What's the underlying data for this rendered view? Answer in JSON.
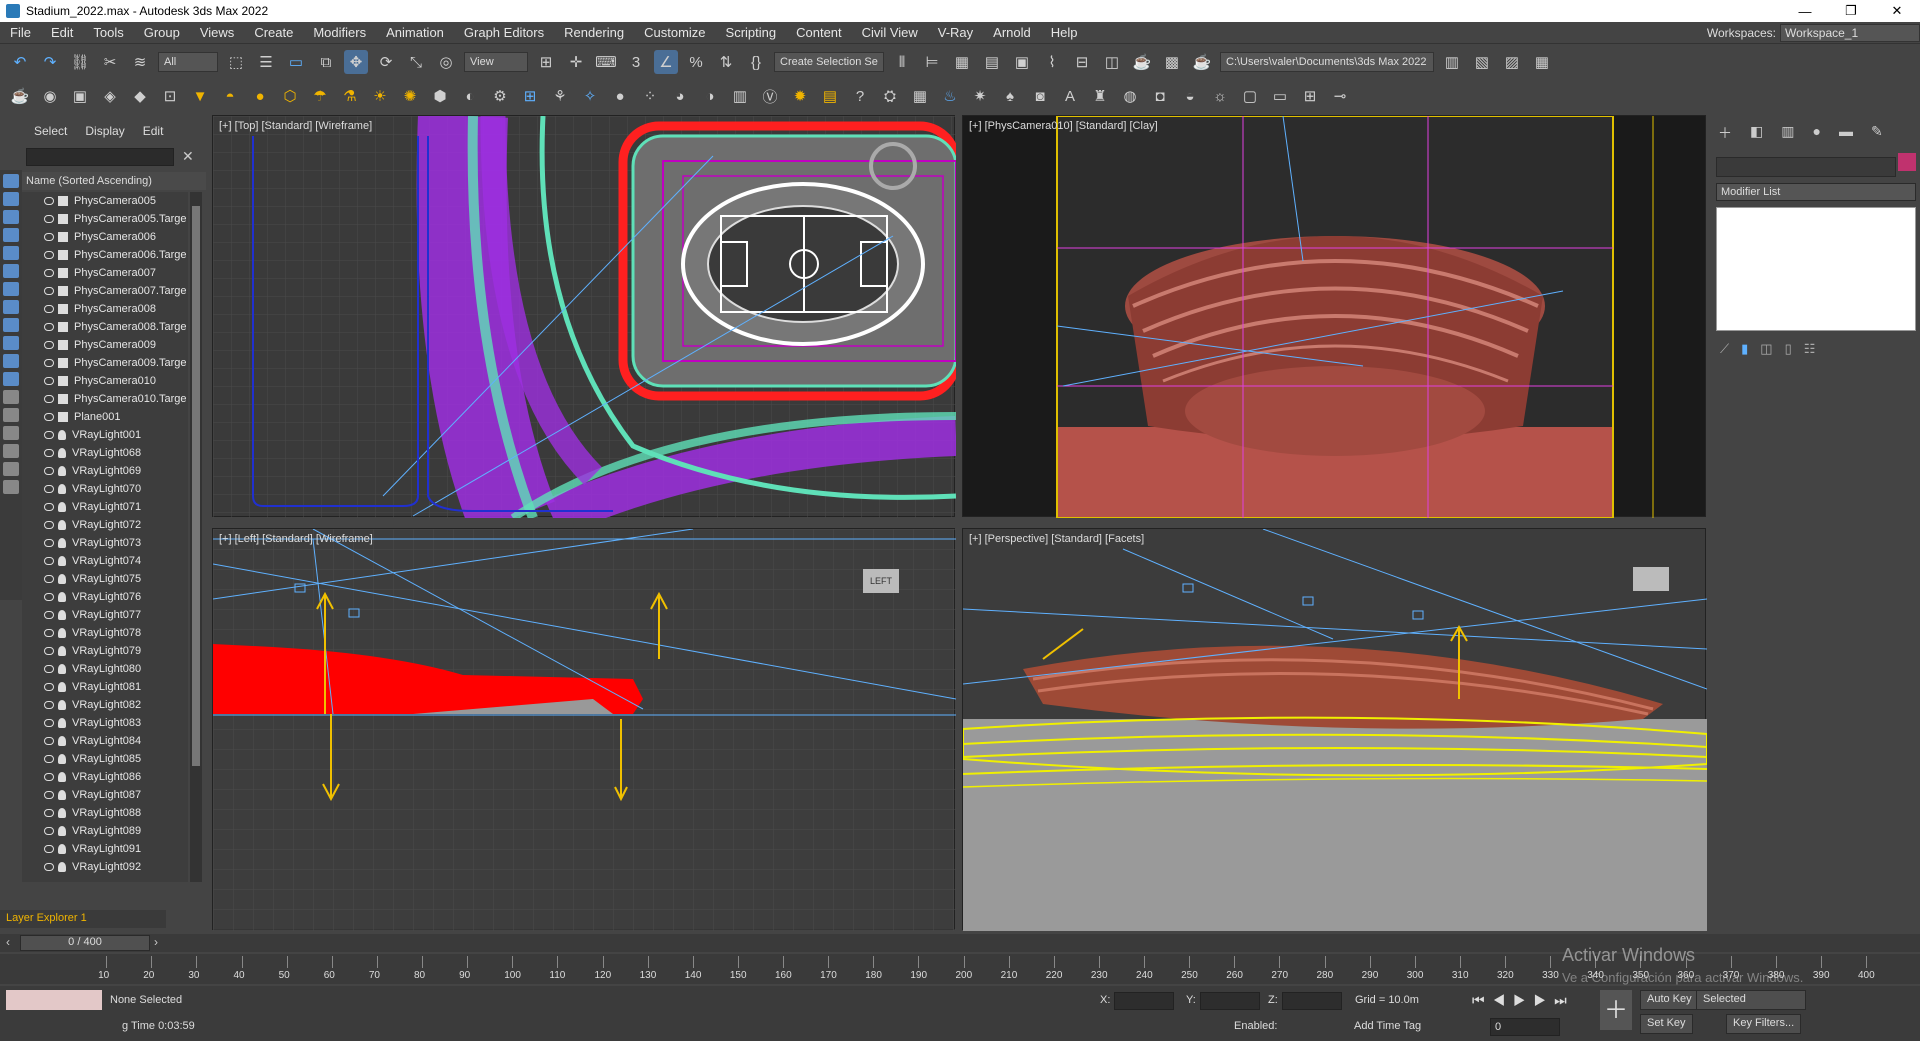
{
  "window": {
    "title": "Stadium_2022.max - Autodesk 3ds Max 2022",
    "min": "—",
    "max": "❐",
    "close": "✕"
  },
  "menu": {
    "items": [
      "File",
      "Edit",
      "Tools",
      "Group",
      "Views",
      "Create",
      "Modifiers",
      "Animation",
      "Graph Editors",
      "Rendering",
      "Customize",
      "Scripting",
      "Content",
      "Civil View",
      "V-Ray",
      "Arnold",
      "Help"
    ],
    "workspaces_label": "Workspaces:",
    "workspace_value": "Workspace_1"
  },
  "toolbar": {
    "filter_value": "All",
    "refcoord_value": "View",
    "selection_set": "Create Selection Se",
    "path_value": "C:\\Users\\valer\\Documents\\3ds Max 2022"
  },
  "scene_explorer": {
    "tabs": [
      "Select",
      "Display",
      "Edit"
    ],
    "header": "Name (Sorted Ascending)",
    "items": [
      {
        "name": "PhysCamera005",
        "type": "camera"
      },
      {
        "name": "PhysCamera005.Targe",
        "type": "camera"
      },
      {
        "name": "PhysCamera006",
        "type": "camera"
      },
      {
        "name": "PhysCamera006.Targe",
        "type": "camera"
      },
      {
        "name": "PhysCamera007",
        "type": "camera"
      },
      {
        "name": "PhysCamera007.Targe",
        "type": "camera"
      },
      {
        "name": "PhysCamera008",
        "type": "camera"
      },
      {
        "name": "PhysCamera008.Targe",
        "type": "camera"
      },
      {
        "name": "PhysCamera009",
        "type": "camera"
      },
      {
        "name": "PhysCamera009.Targe",
        "type": "camera"
      },
      {
        "name": "PhysCamera010",
        "type": "camera"
      },
      {
        "name": "PhysCamera010.Targe",
        "type": "camera"
      },
      {
        "name": "Plane001",
        "type": "geometry"
      },
      {
        "name": "VRayLight001",
        "type": "light"
      },
      {
        "name": "VRayLight068",
        "type": "light"
      },
      {
        "name": "VRayLight069",
        "type": "light"
      },
      {
        "name": "VRayLight070",
        "type": "light"
      },
      {
        "name": "VRayLight071",
        "type": "light"
      },
      {
        "name": "VRayLight072",
        "type": "light"
      },
      {
        "name": "VRayLight073",
        "type": "light"
      },
      {
        "name": "VRayLight074",
        "type": "light"
      },
      {
        "name": "VRayLight075",
        "type": "light"
      },
      {
        "name": "VRayLight076",
        "type": "light"
      },
      {
        "name": "VRayLight077",
        "type": "light"
      },
      {
        "name": "VRayLight078",
        "type": "light"
      },
      {
        "name": "VRayLight079",
        "type": "light"
      },
      {
        "name": "VRayLight080",
        "type": "light"
      },
      {
        "name": "VRayLight081",
        "type": "light"
      },
      {
        "name": "VRayLight082",
        "type": "light"
      },
      {
        "name": "VRayLight083",
        "type": "light"
      },
      {
        "name": "VRayLight084",
        "type": "light"
      },
      {
        "name": "VRayLight085",
        "type": "light"
      },
      {
        "name": "VRayLight086",
        "type": "light"
      },
      {
        "name": "VRayLight087",
        "type": "light"
      },
      {
        "name": "VRayLight088",
        "type": "light"
      },
      {
        "name": "VRayLight089",
        "type": "light"
      },
      {
        "name": "VRayLight091",
        "type": "light"
      },
      {
        "name": "VRayLight092",
        "type": "light"
      }
    ],
    "layer_explorer": "Layer Explorer 1"
  },
  "viewports": {
    "top": "[+] [Top] [Standard] [Wireframe]",
    "camera": "[+] [PhysCamera010] [Standard] [Clay]",
    "left": "[+] [Left] [Standard] [Wireframe]",
    "perspective": "[+] [Perspective] [Standard] [Facets]",
    "viewcube_left": "LEFT"
  },
  "command_panel": {
    "modifier_list": "Modifier List"
  },
  "time": {
    "slider": "0 / 400",
    "ticks": [
      "10",
      "20",
      "30",
      "40",
      "50",
      "60",
      "70",
      "80",
      "90",
      "100",
      "110",
      "120",
      "130",
      "140",
      "150",
      "160",
      "170",
      "180",
      "190",
      "200",
      "210",
      "220",
      "230",
      "240",
      "250",
      "260",
      "270",
      "280",
      "290",
      "300",
      "310",
      "320",
      "330",
      "340",
      "350",
      "360",
      "370",
      "380",
      "390",
      "400"
    ]
  },
  "status": {
    "none_selected": "None Selected",
    "render_time": "g Time  0:03:59",
    "x_label": "X:",
    "y_label": "Y:",
    "z_label": "Z:",
    "grid": "Grid = 10.0m",
    "enabled": "Enabled:",
    "add_time_tag": "Add Time Tag",
    "auto_key": "Auto Key",
    "selected": "Selected",
    "set_key": "Set Key",
    "key_filters": "Key Filters...",
    "frame": "0"
  },
  "watermark": {
    "line1": "Activar Windows",
    "line2": "Ve a Configuración para activar Windows."
  }
}
